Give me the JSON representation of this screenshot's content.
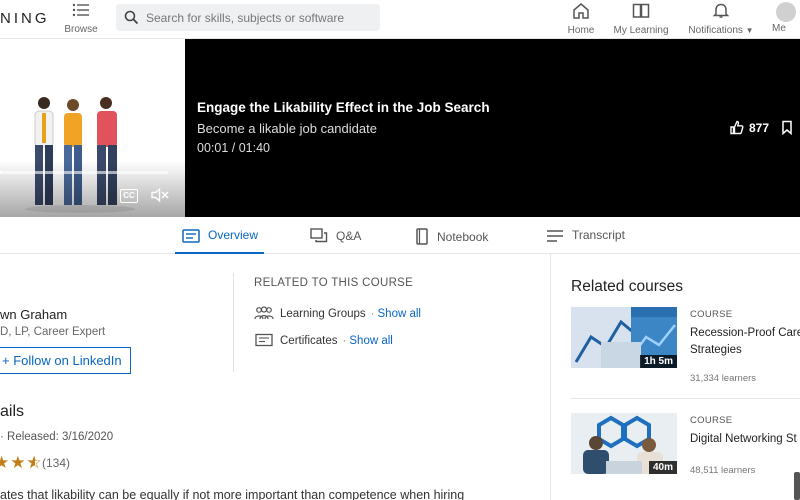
{
  "header": {
    "logo_text": "NING",
    "browse_label": "Browse",
    "search_placeholder": "Search for skills, subjects or software",
    "nav": {
      "home": "Home",
      "my_learning": "My Learning",
      "notifications": "Notifications",
      "me": "Me"
    }
  },
  "video": {
    "title": "Engage the Likability Effect in the Job Search",
    "subtitle": "Become a likable job candidate",
    "time": "00:01 / 01:40",
    "likes": "877",
    "progress_fraction": 0.01,
    "cc_label": "CC"
  },
  "tabs": [
    {
      "label": "Overview",
      "icon": "overview-icon",
      "active": true
    },
    {
      "label": "Q&A",
      "icon": "qa-icon",
      "active": false
    },
    {
      "label": "Notebook",
      "icon": "notebook-icon",
      "active": false
    },
    {
      "label": "Transcript",
      "icon": "transcript-icon",
      "active": false
    }
  ],
  "author": {
    "name": "wn Graham",
    "title": "D, LP, Career Expert",
    "follow_label": "Follow on LinkedIn"
  },
  "details": {
    "heading": "ails",
    "released": "·  Released: 3/16/2020",
    "rating_stars": 3.5,
    "rating_count": "(134)",
    "description": "ates that likability can be equally if not more important than competence when hiring"
  },
  "related_to_course": {
    "heading": "RELATED TO THIS COURSE",
    "items": [
      {
        "label": "Learning Groups",
        "link": "Show all",
        "icon": "learning-groups-icon"
      },
      {
        "label": "Certificates",
        "link": "Show all",
        "icon": "certificate-icon"
      }
    ]
  },
  "related_courses": {
    "heading": "Related courses",
    "items": [
      {
        "label": "COURSE",
        "title": "Recession-Proof Caree Strategies",
        "duration": "1h 5m",
        "learners": "31,334 learners"
      },
      {
        "label": "COURSE",
        "title": "Digital Networking St",
        "duration": "40m",
        "learners": "48,511 learners"
      }
    ]
  },
  "colors": {
    "accent": "#0a66c2",
    "star": "#c37d16",
    "video_bg": "#000000"
  }
}
